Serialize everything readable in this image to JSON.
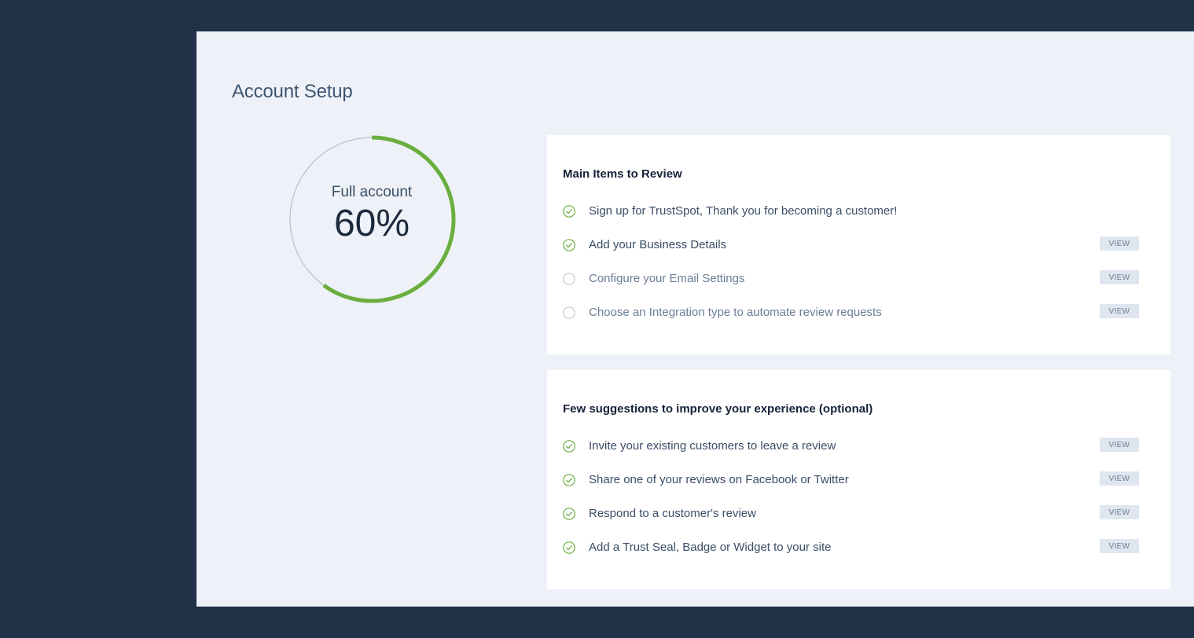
{
  "page": {
    "title": "Account Setup"
  },
  "progress": {
    "label": "Full account",
    "value_text": "60%",
    "fraction": 0.6,
    "colors": {
      "track": "#b4bfcc",
      "fill": "#6aae3f"
    }
  },
  "main_items": {
    "title": "Main Items to Review",
    "items": [
      {
        "label": "Sign up for TrustSpot, Thank you for becoming a customer!",
        "completed": true,
        "action": ""
      },
      {
        "label": "Add your Business Details",
        "completed": true,
        "action": "VIEW"
      },
      {
        "label": "Configure your Email Settings",
        "completed": false,
        "action": "VIEW"
      },
      {
        "label": "Choose an Integration type to automate review requests",
        "completed": false,
        "action": "VIEW"
      }
    ]
  },
  "suggestions": {
    "title": "Few suggestions to improve your experience (optional)",
    "items": [
      {
        "label": "Invite your existing customers to leave a review",
        "completed": true,
        "action": "VIEW"
      },
      {
        "label": "Share one of your reviews on Facebook or Twitter",
        "completed": true,
        "action": "VIEW"
      },
      {
        "label": "Respond to a customer's review",
        "completed": true,
        "action": "VIEW"
      },
      {
        "label": "Add a Trust Seal, Badge or Widget to your site",
        "completed": true,
        "action": "VIEW"
      }
    ]
  },
  "colors": {
    "background": "#213147",
    "panel": "#eef2f8",
    "check": "#6aae3f",
    "pending": "#c3cbd6",
    "button_bg": "#dfe6ef"
  }
}
